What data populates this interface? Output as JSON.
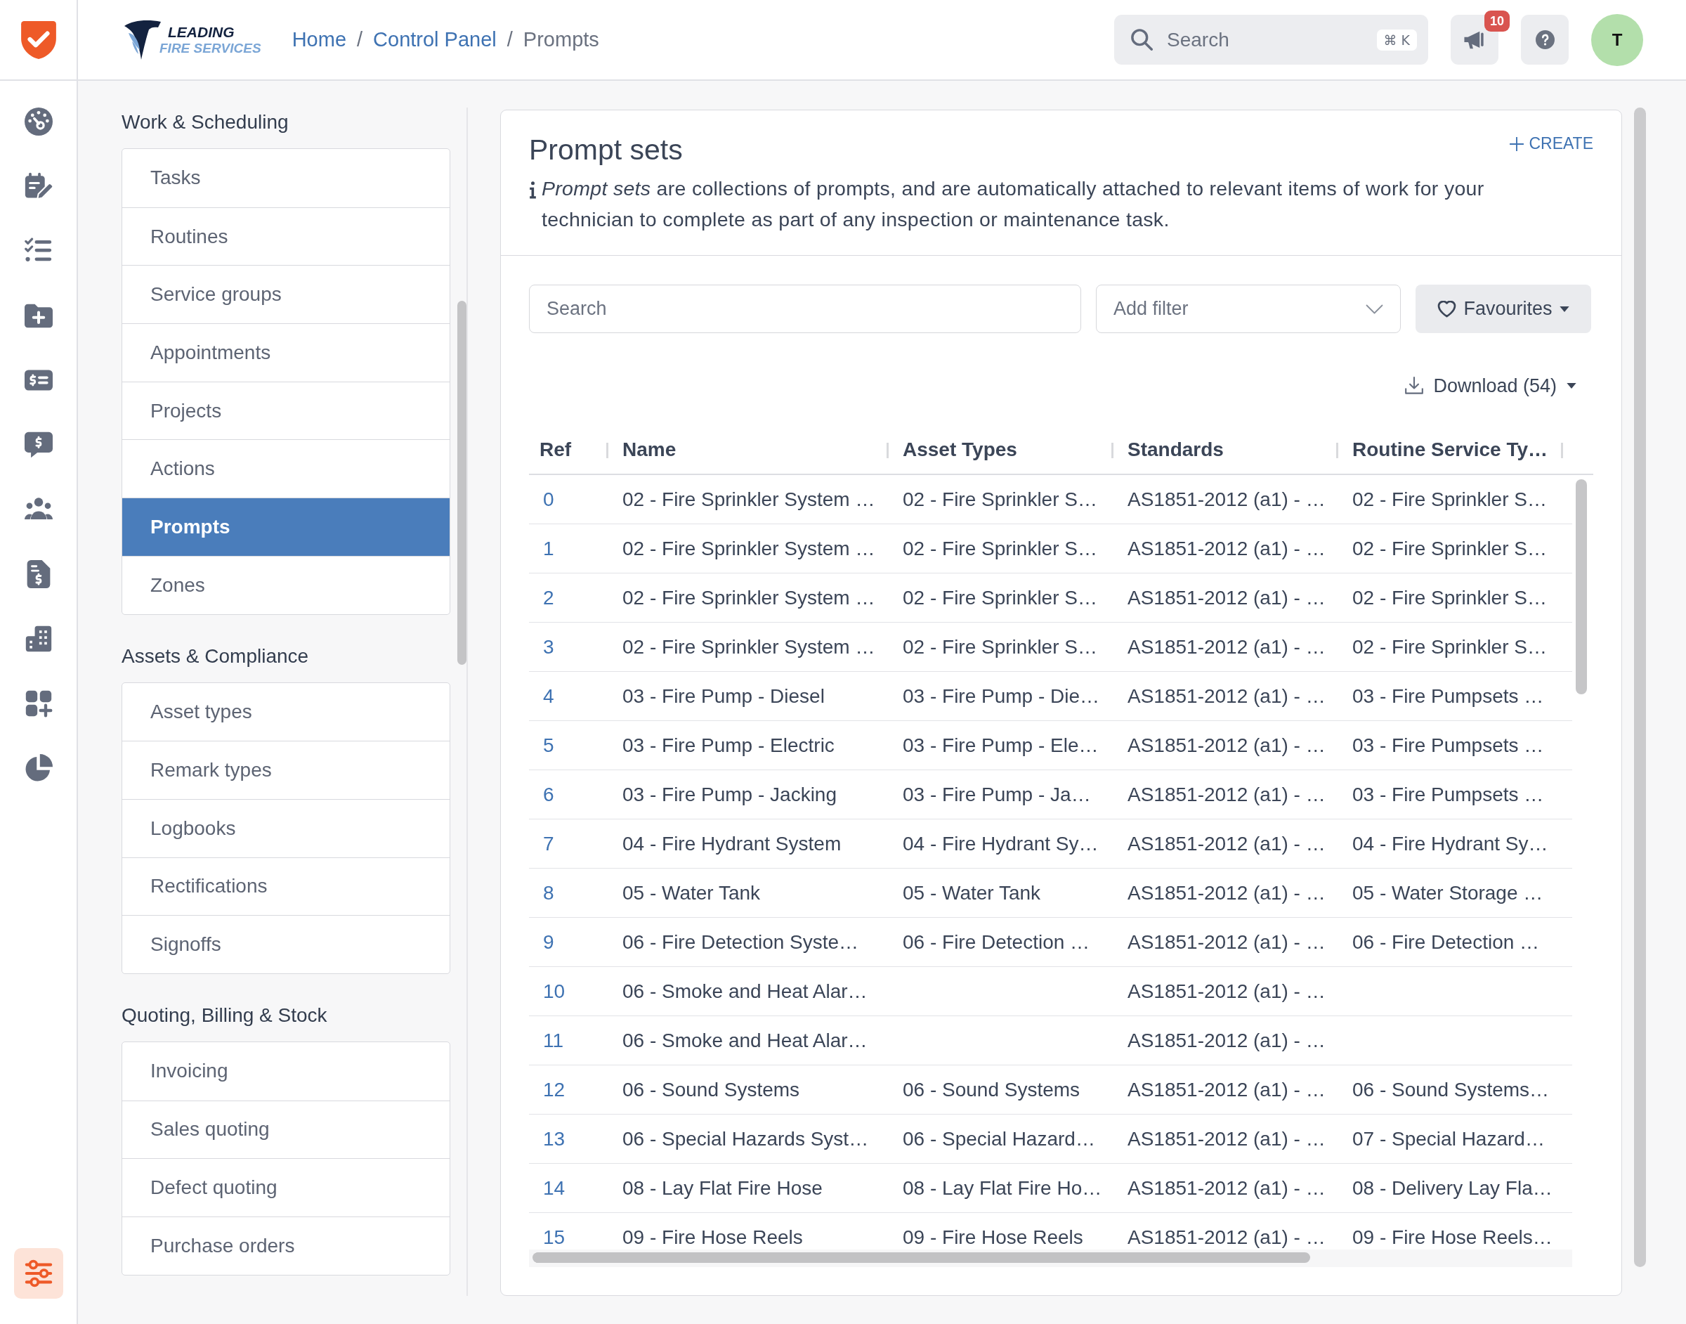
{
  "app_bar": {
    "brand": {
      "line_1": "LEADING",
      "line_2": "FIRE SERVICES"
    },
    "breadcrumb": [
      {
        "kind": "link",
        "label": "Home"
      },
      {
        "kind": "separator",
        "label": "/"
      },
      {
        "kind": "link",
        "label": "Control Panel"
      },
      {
        "kind": "separator",
        "label": "/"
      },
      {
        "kind": "current",
        "label": "Prompts"
      }
    ],
    "search": {
      "placeholder": "Search",
      "shortcut": "⌘ K"
    },
    "announcements": {
      "count": "10"
    },
    "avatar": {
      "initial": "T"
    }
  },
  "rail": {
    "items": [
      {
        "kind": "dashboard",
        "selected": false
      },
      {
        "kind": "calendar",
        "selected": false
      },
      {
        "kind": "checklist",
        "selected": false
      },
      {
        "kind": "folder",
        "selected": false
      },
      {
        "kind": "billing",
        "selected": false
      },
      {
        "kind": "quote",
        "selected": false
      },
      {
        "kind": "people",
        "selected": false
      },
      {
        "kind": "invoice",
        "selected": false
      },
      {
        "kind": "building",
        "selected": false
      },
      {
        "kind": "apps",
        "selected": false
      },
      {
        "kind": "reports",
        "selected": false
      }
    ],
    "footer_items": [
      {
        "kind": "settings",
        "selected": true
      }
    ]
  },
  "sidebar": {
    "sections": [
      {
        "title": "Work & Scheduling",
        "items": [
          {
            "label": "Tasks",
            "selected": false
          },
          {
            "label": "Routines",
            "selected": false
          },
          {
            "label": "Service groups",
            "selected": false
          },
          {
            "label": "Appointments",
            "selected": false
          },
          {
            "label": "Projects",
            "selected": false
          },
          {
            "label": "Actions",
            "selected": false
          },
          {
            "label": "Prompts",
            "selected": true
          },
          {
            "label": "Zones",
            "selected": false
          }
        ]
      },
      {
        "title": "Assets & Compliance",
        "items": [
          {
            "label": "Asset types",
            "selected": false
          },
          {
            "label": "Remark types",
            "selected": false
          },
          {
            "label": "Logbooks",
            "selected": false
          },
          {
            "label": "Rectifications",
            "selected": false
          },
          {
            "label": "Signoffs",
            "selected": false
          }
        ]
      },
      {
        "title": "Quoting, Billing & Stock",
        "items": [
          {
            "label": "Invoicing",
            "selected": false
          },
          {
            "label": "Sales quoting",
            "selected": false
          },
          {
            "label": "Defect quoting",
            "selected": false
          },
          {
            "label": "Purchase orders",
            "selected": false
          }
        ]
      }
    ]
  },
  "panel": {
    "title": "Prompt sets",
    "create_label": "CREATE",
    "description": "*Prompt sets* are collections of prompts, and are automatically attached to relevant items of work for your technician to complete as part of any inspection or maintenance task.",
    "search": {
      "placeholder": "Search"
    },
    "filter": {
      "placeholder": "Add filter"
    },
    "favourites_label": "Favourites",
    "download_label": "Download (54)",
    "table": {
      "columns": [
        "Ref",
        "Name",
        "Asset Types",
        "Standards",
        "Routine Service Ty…"
      ],
      "rows": [
        {
          "ref": "0",
          "name": "02 - Fire Sprinkler System …",
          "asset_types": "02 - Fire Sprinkler S…",
          "standards": "AS1851-2012 (a1) - …",
          "routine_service": "02 - Fire Sprinkler S…"
        },
        {
          "ref": "1",
          "name": "02 - Fire Sprinkler System …",
          "asset_types": "02 - Fire Sprinkler S…",
          "standards": "AS1851-2012 (a1) - …",
          "routine_service": "02 - Fire Sprinkler S…"
        },
        {
          "ref": "2",
          "name": "02 - Fire Sprinkler System …",
          "asset_types": "02 - Fire Sprinkler S…",
          "standards": "AS1851-2012 (a1) - …",
          "routine_service": "02 - Fire Sprinkler S…"
        },
        {
          "ref": "3",
          "name": "02 - Fire Sprinkler System …",
          "asset_types": "02 - Fire Sprinkler S…",
          "standards": "AS1851-2012 (a1) - …",
          "routine_service": "02 - Fire Sprinkler S…"
        },
        {
          "ref": "4",
          "name": "03 - Fire Pump - Diesel",
          "asset_types": "03 - Fire Pump - Die…",
          "standards": "AS1851-2012 (a1) - …",
          "routine_service": "03 - Fire Pumpsets …"
        },
        {
          "ref": "5",
          "name": "03 - Fire Pump - Electric",
          "asset_types": "03 - Fire Pump - Ele…",
          "standards": "AS1851-2012 (a1) - …",
          "routine_service": "03 - Fire Pumpsets …"
        },
        {
          "ref": "6",
          "name": "03 - Fire Pump - Jacking",
          "asset_types": "03 - Fire Pump - Ja…",
          "standards": "AS1851-2012 (a1) - …",
          "routine_service": "03 - Fire Pumpsets …"
        },
        {
          "ref": "7",
          "name": "04 - Fire Hydrant System",
          "asset_types": "04 - Fire Hydrant Sy…",
          "standards": "AS1851-2012 (a1) - …",
          "routine_service": "04 - Fire Hydrant Sy…"
        },
        {
          "ref": "8",
          "name": "05 - Water Tank",
          "asset_types": "05 - Water Tank",
          "standards": "AS1851-2012 (a1) - …",
          "routine_service": "05 - Water Storage …"
        },
        {
          "ref": "9",
          "name": "06 - Fire Detection Syste…",
          "asset_types": "06 - Fire Detection …",
          "standards": "AS1851-2012 (a1) - …",
          "routine_service": "06 - Fire Detection …"
        },
        {
          "ref": "10",
          "name": "06 - Smoke and Heat Alar…",
          "standards": "AS1851-2012 (a1) - …"
        },
        {
          "ref": "11",
          "name": "06 - Smoke and Heat Alar…",
          "standards": "AS1851-2012 (a1) - …"
        },
        {
          "ref": "12",
          "name": "06 - Sound Systems",
          "asset_types": "06 - Sound Systems",
          "standards": "AS1851-2012 (a1) - …",
          "routine_service": "06 - Sound Systems…"
        },
        {
          "ref": "13",
          "name": "06 - Special Hazards Syst…",
          "asset_types": "06 - Special Hazard…",
          "standards": "AS1851-2012 (a1) - …",
          "routine_service": "07 - Special Hazard…"
        },
        {
          "ref": "14",
          "name": "08 - Lay Flat Fire Hose",
          "asset_types": "08 - Lay Flat Fire Ho…",
          "standards": "AS1851-2012 (a1) - …",
          "routine_service": "08 - Delivery Lay Fla…"
        },
        {
          "ref": "15",
          "name": "09 - Fire Hose Reels",
          "asset_types": "09 - Fire Hose Reels",
          "standards": "AS1851-2012 (a1) - …",
          "routine_service": "09 - Fire Hose Reels…"
        }
      ]
    }
  }
}
